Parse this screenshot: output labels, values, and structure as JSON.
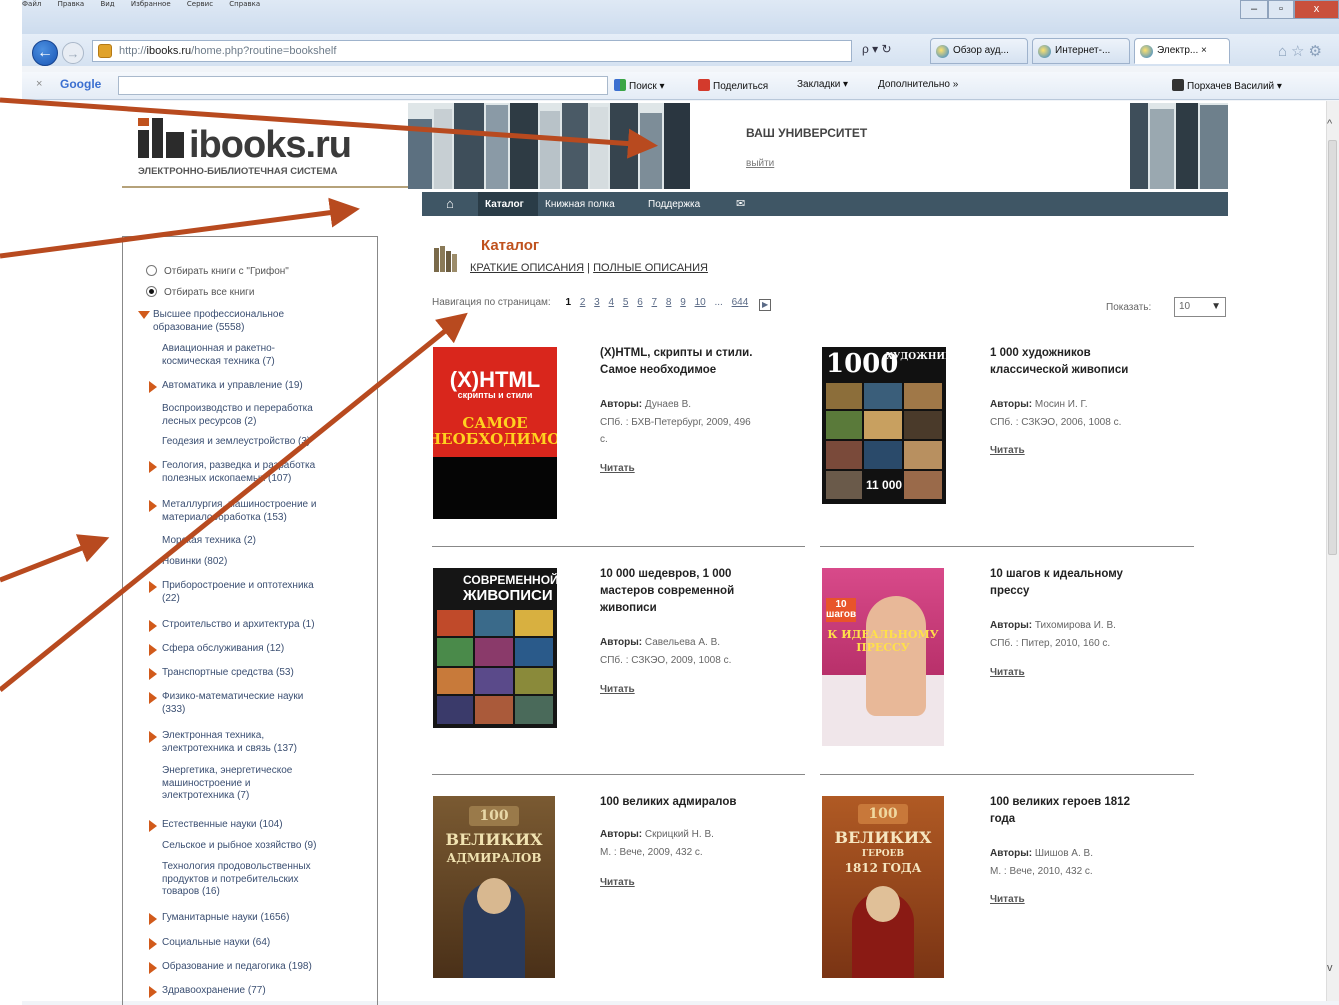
{
  "browser": {
    "menu_items": [
      "Файл",
      "Правка",
      "Вид",
      "Избранное",
      "Сервис",
      "Справка"
    ],
    "address": {
      "prefix": "http://",
      "host": "ibooks.ru",
      "path": "/home.php?routine=bookshelf"
    },
    "address_tools": "ρ ▾ ↻",
    "tabs": [
      {
        "label": "Обзор ауд..."
      },
      {
        "label": "Интернет-..."
      },
      {
        "label": "Электр...  ×"
      }
    ],
    "toolbar": {
      "google_close": "×",
      "google_label": "Google",
      "search_label": "Поиск ▾",
      "share_label": "Поделиться",
      "bookmarks_label": "Закладки ▾",
      "more_label": "Дополнительно »",
      "user_label": "Порхачев Василий ▾"
    }
  },
  "site": {
    "logo_text": "ibooks.ru",
    "logo_subtitle": "ЭЛЕКТРОННО-БИБЛИОТЕЧНАЯ СИСТЕМА",
    "university_title": "ВАШ УНИВЕРСИТЕТ",
    "logout_label": "выйти",
    "nav": {
      "home_icon": "home-icon",
      "catalog": "Каталог",
      "bookshelf": "Книжная полка",
      "support": "Поддержка",
      "mail_icon": "mail-icon"
    }
  },
  "sidebar": {
    "filter_grifon": "Отбирать книги с \"Грифон\"",
    "filter_all": "Отбирать все книги",
    "selected_filter": "filter_all",
    "categories": [
      {
        "label": "Высшее профессиональное",
        "label2": "образование (5558)",
        "expanded": true
      },
      {
        "label": "Авиационная и ракетно-",
        "label2": "космическая техника (7)"
      },
      {
        "label": "Автоматика и управление (19)",
        "has_children": true
      },
      {
        "label": "Воспроизводство и переработка",
        "label2": "лесных ресурсов (2)"
      },
      {
        "label": "Геодезия и землеустройство (3)"
      },
      {
        "label": "Геология, разведка и разработка",
        "label2": "полезных ископаемых (107)",
        "has_children": true
      },
      {
        "label": "Металлургия, машиностроение и",
        "label2": "материалообработка (153)",
        "has_children": true
      },
      {
        "label": "Морская техника (2)"
      },
      {
        "label": "Новинки (802)"
      },
      {
        "label": "Приборостроение и оптотехника",
        "label2": "(22)",
        "has_children": true
      },
      {
        "label": "Строительство и архитектура (1)",
        "has_children": true
      },
      {
        "label": "Сфера обслуживания (12)",
        "has_children": true
      },
      {
        "label": "Транспортные средства (53)",
        "has_children": true
      },
      {
        "label": "Физико-математические науки",
        "label2": "(333)",
        "has_children": true
      },
      {
        "label": "Электронная техника,",
        "label2": "электротехника и связь (137)",
        "has_children": true
      },
      {
        "label": "Энергетика, энергетическое",
        "label2": "машиностроение и",
        "label3": "электротехника (7)"
      },
      {
        "label": "Естественные науки (104)",
        "has_children": true
      },
      {
        "label": "Сельское и рыбное хозяйство (9)"
      },
      {
        "label": "Технология продовольственных",
        "label2": "продуктов и потребительских",
        "label3": "товаров (16)"
      },
      {
        "label": "Гуманитарные науки (1656)",
        "has_children": true
      },
      {
        "label": "Социальные науки (64)",
        "has_children": true
      },
      {
        "label": "Образование и педагогика (198)",
        "has_children": true
      },
      {
        "label": "Здравоохранение (77)",
        "has_children": true
      }
    ]
  },
  "catalog": {
    "title": "Каталог",
    "view_short": "КРАТКИЕ ОПИСАНИЯ",
    "view_divider": " | ",
    "view_full": "ПОЛНЫЕ ОПИСАНИЯ",
    "pager_label": "Навигация по страницам:",
    "current_page": "1",
    "pages": [
      "2",
      "3",
      "4",
      "5",
      "6",
      "7",
      "8",
      "9",
      "10"
    ],
    "ellipsis": "...",
    "last_page": "644",
    "next_icon": "▶",
    "show_label": "Показать:",
    "show_value": "10",
    "read_label": "Читать",
    "authors_label": "Авторы:",
    "books": [
      {
        "title_l1": "(X)HTML, скрипты и стили.",
        "title_l2": "Самое необходимое",
        "authors": "Дунаев В.",
        "pub_l1": "СПб. : БХВ-Петербург, 2009, 496",
        "pub_l2": "с.",
        "cover": {
          "main": "(X)HTML",
          "sub": "скрипты и стили",
          "big": "САМОЕ НЕОБХОДИМОЕ",
          "bg": "#d9261c"
        }
      },
      {
        "title_l1": "1 000 художников",
        "title_l2": "классической живописи",
        "authors": "Мосин И. Г.",
        "pub_l1": "СПб. : СЗКЭО, 2006, 1008 с.",
        "cover": {
          "main": "1000",
          "side": "ХУДОЖНИКОВ",
          "bottom": "11 000",
          "bg": "#111"
        }
      },
      {
        "title_l1": "10 000 шедевров, 1 000",
        "title_l2": "мастеров современной",
        "title_l3": "живописи",
        "authors": "Савельева А. В.",
        "pub_l1": "СПб. : СЗКЭО, 2009, 1008 с.",
        "cover": {
          "main": "СОВРЕМЕННОЙ",
          "sub": "ЖИВОПИСИ",
          "bg": "#151515"
        }
      },
      {
        "title_l1": "10 шагов к идеальному",
        "title_l2": "прессу",
        "authors": "Тихомирова И. В.",
        "pub_l1": "СПб. : Питер, 2010, 160 с.",
        "cover": {
          "main": "10 шагов",
          "sub": "К ИДЕАЛЬНОМУ ПРЕССУ",
          "bg": "#c8357a"
        }
      },
      {
        "title_l1": "100 великих адмиралов",
        "authors": "Скрицкий Н. В.",
        "pub_l1": "М. : Вече, 2009, 432 с.",
        "cover": {
          "main": "100",
          "sub": "ВЕЛИКИХ",
          "sub2": "АДМИРАЛОВ",
          "bg": "#6a4a2a"
        }
      },
      {
        "title_l1": "100 великих героев 1812",
        "title_l2": "года",
        "authors": "Шишов А. В.",
        "pub_l1": "М. : Вече, 2010, 432 с.",
        "cover": {
          "main": "100",
          "sub": "ВЕЛИКИХ",
          "sub2": "ГЕРОЕВ",
          "sub3": "1812 ГОДА",
          "bg": "#9a4a1e"
        }
      }
    ]
  },
  "annotation": {
    "arrow_color": "#b84a1f"
  }
}
